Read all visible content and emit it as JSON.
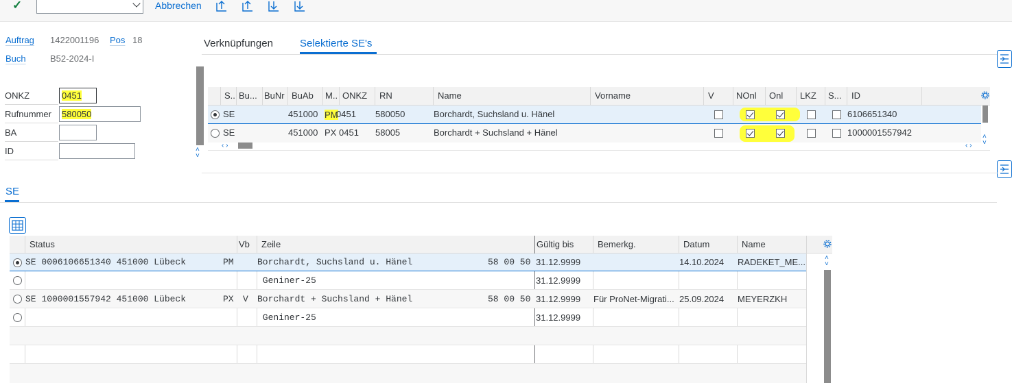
{
  "toolbar": {
    "check_icon": "checkmark-icon",
    "combo_value": "",
    "cancel_label": "Abbrechen",
    "icons": [
      "export-up-icon",
      "export-up-icon",
      "import-down-icon",
      "import-down-icon"
    ]
  },
  "header": {
    "auftrag_label": "Auftrag",
    "auftrag_value": "1422001196",
    "pos_label": "Pos",
    "pos_value": "18",
    "buch_label": "Buch",
    "buch_value": "B52-2024-I"
  },
  "form": {
    "onkz_label": "ONKZ",
    "onkz_value": "0451",
    "rufnummer_label": "Rufnummer",
    "rufnummer_value": "580050",
    "ba_label": "BA",
    "ba_value": "",
    "id_label": "ID",
    "id_value": ""
  },
  "tabs": {
    "tab1": "Verknüpfungen",
    "tab2": "Selektierte SE's"
  },
  "se_table": {
    "columns": [
      "S..",
      "Bu...",
      "BuNr",
      "BuAb",
      "M..",
      "ONKZ",
      "RN",
      "Name",
      "Vorname",
      "V",
      "NOnl",
      "Onl",
      "LKZ",
      "S...",
      "ID"
    ],
    "rows": [
      {
        "selected": true,
        "s": "SE",
        "bu": "",
        "bunr": "",
        "buab": "451000",
        "m_prefix": "PM",
        "onkz": "0451",
        "rn": "580050",
        "name": "Borchardt, Suchsland u. Hänel",
        "vorname": "",
        "v": false,
        "nonl": true,
        "onl": true,
        "lkz": false,
        "s2": false,
        "id": "6106651340"
      },
      {
        "selected": false,
        "s": "SE",
        "bu": "",
        "bunr": "",
        "buab": "451000",
        "m_prefix": "PX",
        "onkz": "0451",
        "rn": "58005",
        "name": "Borchardt + Suchsland + Hänel",
        "vorname": "",
        "v": false,
        "nonl": true,
        "onl": true,
        "lkz": false,
        "s2": false,
        "id": "1000001557942"
      }
    ]
  },
  "se_section": {
    "title": "SE"
  },
  "lower_table": {
    "columns": [
      "Status",
      "Vb",
      "Zeile",
      "Gültig bis",
      "Bemerkg.",
      "Datum",
      "Name"
    ],
    "rows": [
      {
        "selected": true,
        "status": "SE 0006106651340 451000 Lübeck",
        "m": "PM",
        "vb": "",
        "zeile": "Borchardt, Suchsland u. Hänel",
        "num": "58 00 50",
        "gueltig": "31.12.9999",
        "bemerkg": "",
        "datum": "14.10.2024",
        "name": "RADEKET_ME..."
      },
      {
        "selected": false,
        "status": "",
        "m": "",
        "vb": "",
        "zeile": " Geniner-25",
        "num": "",
        "gueltig": "31.12.9999",
        "bemerkg": "",
        "datum": "",
        "name": ""
      },
      {
        "selected": false,
        "status": "SE 1000001557942 451000 Lübeck",
        "m": "PX",
        "vb": "V",
        "zeile": "Borchardt + Suchsland + Hänel",
        "num": "58 00 50",
        "gueltig": "31.12.9999",
        "bemerkg": "Für ProNet-Migrati...",
        "datum": "25.09.2024",
        "name": "MEYERZKH"
      },
      {
        "selected": false,
        "status": "",
        "m": "",
        "vb": "",
        "zeile": " Geniner-25",
        "num": "",
        "gueltig": "31.12.9999",
        "bemerkg": "",
        "datum": "",
        "name": ""
      }
    ]
  },
  "colors": {
    "accent": "#0a6ed1",
    "highlight": "#ffff3b",
    "check_green": "#107e3e"
  }
}
